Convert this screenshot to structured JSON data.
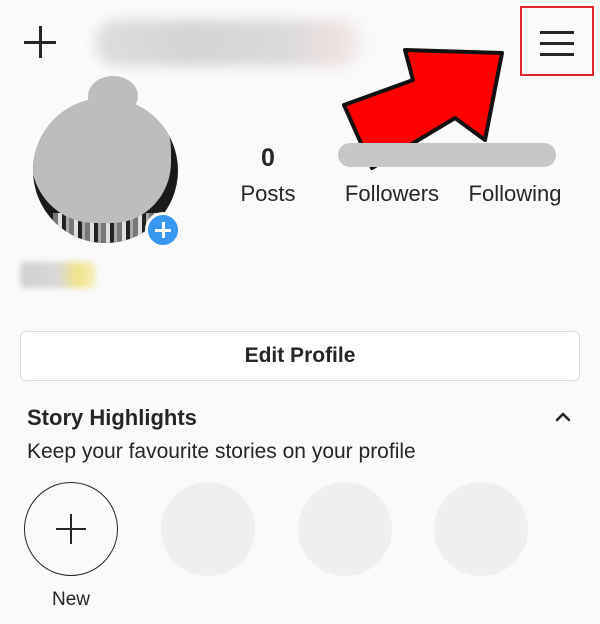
{
  "stats": {
    "posts": {
      "count": "0",
      "label": "Posts"
    },
    "followers": {
      "label": "Followers"
    },
    "following": {
      "label": "Following"
    }
  },
  "edit_profile_label": "Edit Profile",
  "highlights": {
    "title": "Story Highlights",
    "subtitle": "Keep your favourite stories on your profile",
    "new_label": "New",
    "placeholder_count": 3
  },
  "colors": {
    "accent_blue": "#3897f0",
    "annotation_red": "#e3262b",
    "arrow_red": "#ff0000",
    "background": "#fafafa",
    "text": "#262626"
  },
  "icons": {
    "top_left": "plus-icon",
    "top_right": "hamburger-menu-icon",
    "highlights_toggle": "chevron-up-icon",
    "avatar_badge": "plus-icon",
    "highlight_new": "plus-icon",
    "annotation": "arrow-icon"
  }
}
